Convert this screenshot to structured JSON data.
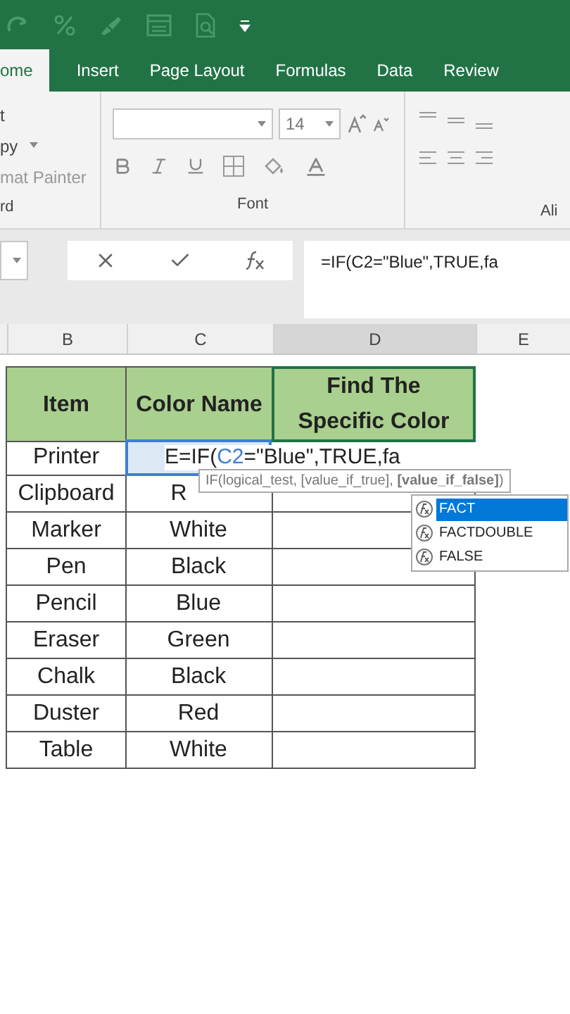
{
  "tabs": [
    {
      "label": "ome",
      "selected": true
    },
    {
      "label": "Insert",
      "selected": false
    },
    {
      "label": "Page Layout",
      "selected": false
    },
    {
      "label": "Formulas",
      "selected": false
    },
    {
      "label": "Data",
      "selected": false
    },
    {
      "label": "Review",
      "selected": false
    }
  ],
  "clipboard": {
    "items": [
      "t",
      "py",
      "mat Painter"
    ],
    "group": "rd"
  },
  "font": {
    "size": "14",
    "group": "Font"
  },
  "alignment": {
    "group": "Ali"
  },
  "formula_bar": {
    "value": "=IF(C2=\"Blue\",TRUE,fa"
  },
  "columns": [
    "B",
    "C",
    "D",
    "E"
  ],
  "headers": [
    "Item",
    "Color Name",
    "Find The Specific Color"
  ],
  "rows": [
    [
      "Printer",
      ""
    ],
    [
      "Clipboard",
      "R"
    ],
    [
      "Marker",
      "White"
    ],
    [
      "Pen",
      "Black"
    ],
    [
      "Pencil",
      "Blue"
    ],
    [
      "Eraser",
      "Green"
    ],
    [
      "Chalk",
      "Black"
    ],
    [
      "Duster",
      "Red"
    ],
    [
      "Table",
      "White"
    ]
  ],
  "editing": {
    "prefix": "E=IF(",
    "ref": "C2",
    "suffix": "=\"Blue\",TRUE,fa"
  },
  "tooltip": "IF(logical_test, [value_if_true], **[value_if_false]**)",
  "autocomplete": [
    {
      "label": "FACT",
      "selected": true
    },
    {
      "label": "FACTDOUBLE",
      "selected": false
    },
    {
      "label": "FALSE",
      "selected": false
    }
  ]
}
